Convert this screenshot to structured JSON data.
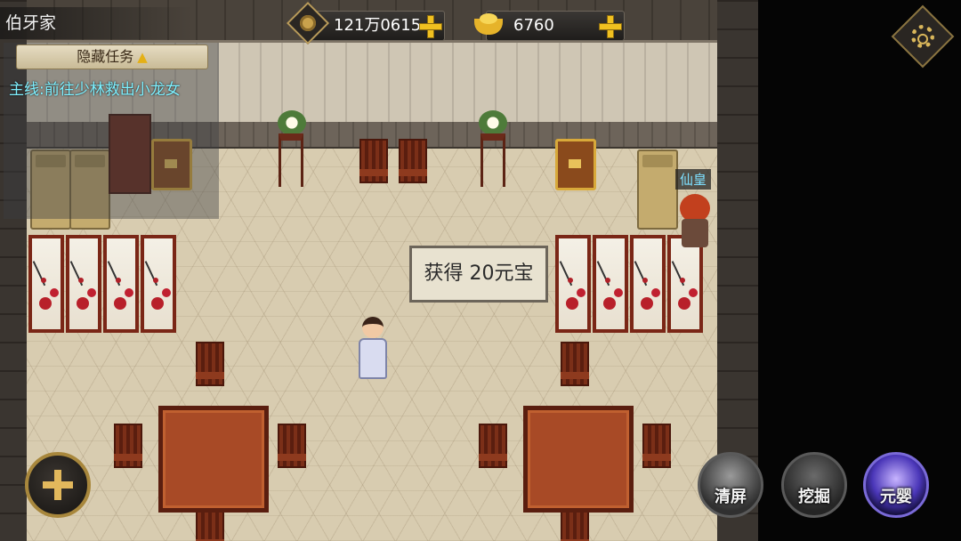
{
  "location": {
    "name": "伯牙家"
  },
  "currencies": [
    {
      "icon": "copper-coin-icon",
      "value": "121万0615"
    },
    {
      "icon": "gold-ingot-icon",
      "value": "6760"
    }
  ],
  "quest": {
    "tab_label": "隐藏任务",
    "main_text": "主线:前往少林救出小龙女"
  },
  "npc": {
    "name": "仙皇"
  },
  "toast": {
    "text": "获得  20元宝"
  },
  "skills": [
    {
      "id": "clear",
      "label": "清屏"
    },
    {
      "id": "dig",
      "label": "挖掘"
    },
    {
      "id": "soul",
      "label": "元婴"
    }
  ],
  "colors": {
    "quest_text": "#7ef0ff",
    "npc_name": "#7ee0ff",
    "accent_gold": "#f0c020"
  }
}
